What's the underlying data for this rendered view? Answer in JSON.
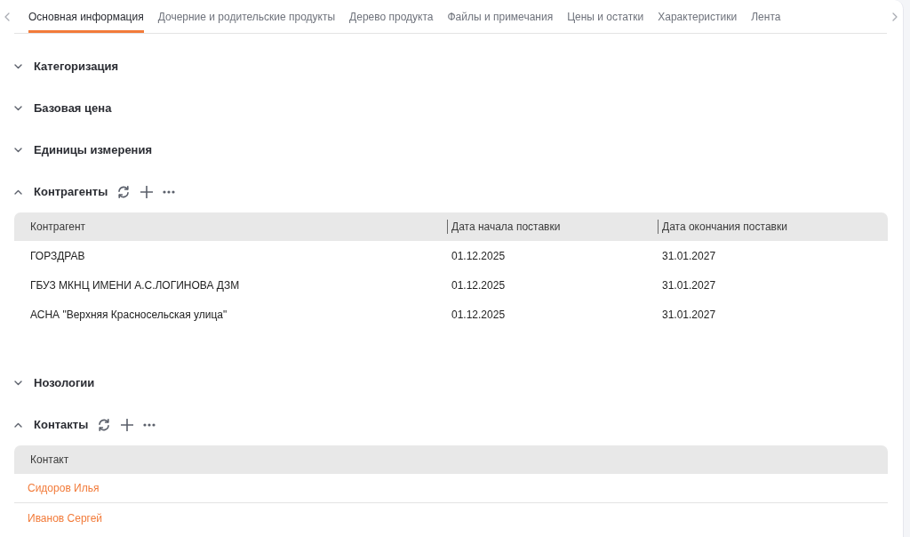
{
  "tabs": [
    {
      "label": "Основная информация",
      "selected": true
    },
    {
      "label": "Дочерние и родительские продукты",
      "selected": false
    },
    {
      "label": "Дерево продукта",
      "selected": false
    },
    {
      "label": "Файлы и примечания",
      "selected": false
    },
    {
      "label": "Цены и остатки",
      "selected": false
    },
    {
      "label": "Характеристики",
      "selected": false
    },
    {
      "label": "Лента",
      "selected": false
    }
  ],
  "sections": [
    {
      "title": "Категоризация",
      "expanded": false
    },
    {
      "title": "Базовая цена",
      "expanded": false
    },
    {
      "title": "Единицы измерения",
      "expanded": false
    },
    {
      "title": "Контрагенты",
      "expanded": true,
      "table": {
        "kind": "plain",
        "columns": [
          "Контрагент",
          "Дата начала поставки",
          "Дата окончания поставки"
        ],
        "rows": [
          [
            "ГОРЗДРАВ",
            "01.12.2025",
            "31.01.2027"
          ],
          [
            "ГБУЗ МКНЦ ИМЕНИ А.С.ЛОГИНОВА ДЗМ",
            "01.12.2025",
            "31.01.2027"
          ],
          [
            "АСНА \"Верхняя Красносельская улица\"",
            "01.12.2025",
            "31.01.2027"
          ]
        ]
      }
    },
    {
      "title": "Нозологии",
      "expanded": false
    },
    {
      "title": "Контакты",
      "expanded": true,
      "table": {
        "kind": "links",
        "columns": [
          "Контакт"
        ],
        "rows": [
          [
            "Сидоров Илья"
          ],
          [
            "Иванов Сергей"
          ]
        ]
      }
    }
  ]
}
